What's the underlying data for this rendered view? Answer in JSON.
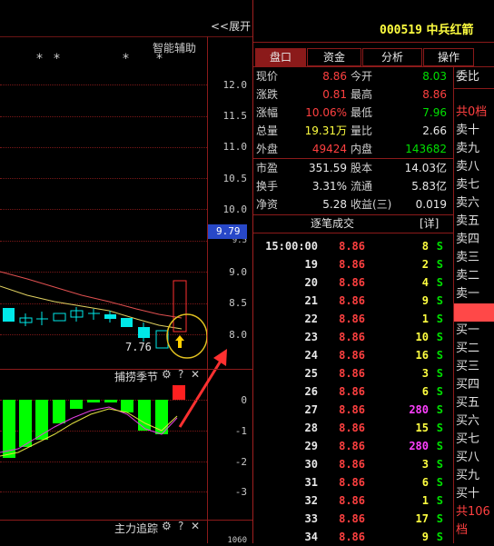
{
  "header": {
    "expand_label": "<<展开",
    "stock_code": "000519",
    "stock_name": "中兵红箭"
  },
  "chart": {
    "assist_label": "智能辅助",
    "markers": [
      "*",
      "*",
      "*",
      "*"
    ],
    "price_ticks": [
      "12.0",
      "11.5",
      "11.0",
      "10.5",
      "10.0",
      "9.5",
      "9.0",
      "8.5",
      "8.0"
    ],
    "current_price_tag": "9.79",
    "low_label": "7.76",
    "indicator1_name": "捕捞季节",
    "indicator1_ticks": [
      "0",
      "-1",
      "-2",
      "-3"
    ],
    "indicator2_name": "主力追踪",
    "indicator2_tick": "1060",
    "gear_icon": "⚙",
    "help_icon": "?",
    "close_icon": "✕"
  },
  "tabs": [
    {
      "label": "盘口",
      "active": true
    },
    {
      "label": "资金",
      "active": false
    },
    {
      "label": "分析",
      "active": false
    },
    {
      "label": "操作",
      "active": false
    }
  ],
  "quote": {
    "now_label": "现价",
    "now": "8.86",
    "open_label": "今开",
    "open": "8.03",
    "chg_label": "涨跌",
    "chg": "0.81",
    "high_label": "最高",
    "high": "8.86",
    "pct_label": "涨幅",
    "pct": "10.06%",
    "low_label": "最低",
    "low": "7.96",
    "vol_label": "总量",
    "vol": "19.31万",
    "ratio_label": "量比",
    "ratio": "2.66",
    "outer_label": "外盘",
    "outer": "49424",
    "inner_label": "内盘",
    "inner": "143682",
    "pe_label": "市盈",
    "pe": "351.59",
    "cap_label": "股本",
    "cap": "14.03亿",
    "turn_label": "换手",
    "turn": "3.31%",
    "float_label": "流通",
    "float": "5.83亿",
    "nav_label": "净资",
    "nav": "5.28",
    "eps_label": "收益(三)",
    "eps": "0.019"
  },
  "trades": {
    "title": "逐笔成交",
    "detail_label": "[详]",
    "rows": [
      {
        "time": "15:00:00",
        "price": "8.86",
        "vol": "8",
        "side": "S",
        "big": false
      },
      {
        "time": "19",
        "price": "8.86",
        "vol": "2",
        "side": "S",
        "big": false
      },
      {
        "time": "20",
        "price": "8.86",
        "vol": "4",
        "side": "S",
        "big": false
      },
      {
        "time": "21",
        "price": "8.86",
        "vol": "9",
        "side": "S",
        "big": false
      },
      {
        "time": "22",
        "price": "8.86",
        "vol": "1",
        "side": "S",
        "big": false
      },
      {
        "time": "23",
        "price": "8.86",
        "vol": "10",
        "side": "S",
        "big": false
      },
      {
        "time": "24",
        "price": "8.86",
        "vol": "16",
        "side": "S",
        "big": false
      },
      {
        "time": "25",
        "price": "8.86",
        "vol": "3",
        "side": "S",
        "big": false
      },
      {
        "time": "26",
        "price": "8.86",
        "vol": "6",
        "side": "S",
        "big": false
      },
      {
        "time": "27",
        "price": "8.86",
        "vol": "280",
        "side": "S",
        "big": true
      },
      {
        "time": "28",
        "price": "8.86",
        "vol": "15",
        "side": "S",
        "big": false
      },
      {
        "time": "29",
        "price": "8.86",
        "vol": "280",
        "side": "S",
        "big": true
      },
      {
        "time": "30",
        "price": "8.86",
        "vol": "3",
        "side": "S",
        "big": false
      },
      {
        "time": "31",
        "price": "8.86",
        "vol": "6",
        "side": "S",
        "big": false
      },
      {
        "time": "32",
        "price": "8.86",
        "vol": "1",
        "side": "S",
        "big": false
      },
      {
        "time": "33",
        "price": "8.86",
        "vol": "17",
        "side": "S",
        "big": false
      },
      {
        "time": "34",
        "price": "8.86",
        "vol": "9",
        "side": "S",
        "big": false
      }
    ]
  },
  "orderbook": {
    "weibi_label": "委比",
    "sell_count": "共0档",
    "sells": [
      "卖十",
      "卖九",
      "卖八",
      "卖七",
      "卖六",
      "卖五",
      "卖四",
      "卖三",
      "卖二",
      "卖一"
    ],
    "buys": [
      "买一",
      "买二",
      "买三",
      "买四",
      "买五",
      "买六",
      "买七",
      "买八",
      "买九",
      "买十"
    ],
    "buy_count": "共106档"
  },
  "colors": {
    "up": "#ff4040",
    "down": "#00e000",
    "border": "#8b1a1a",
    "accent_yellow": "#ffff40",
    "big_trade": "#ff40ff"
  }
}
